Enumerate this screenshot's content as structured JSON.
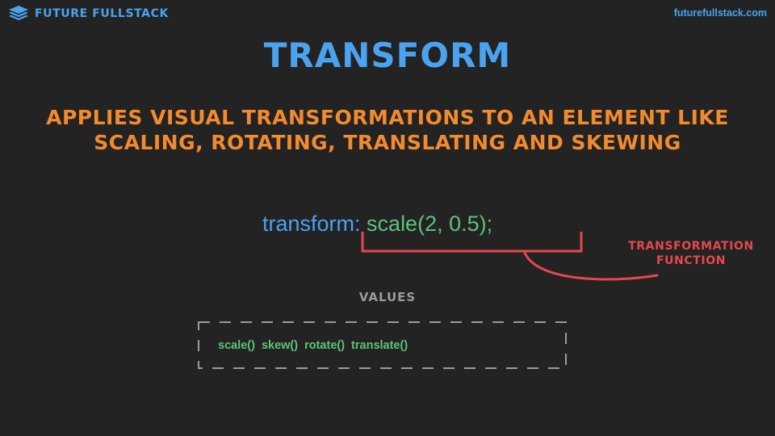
{
  "header": {
    "brand": "FUTURE FULLSTACK",
    "url": "futurefullstack.com",
    "logo_icon": "stacked-layers-icon",
    "accent_color": "#4aa3f0"
  },
  "slide": {
    "title": "TRANSFORM",
    "description_line1": "APPLIES VISUAL TRANSFORMATIONS TO AN ELEMENT LIKE",
    "description_line2": "SCALING, ROTATING, TRANSLATING AND SKEWING",
    "code_property": "transform:",
    "code_value": "scale(2, 0.5);",
    "annotation_line1": "TRANSFORMATION",
    "annotation_line2": "FUNCTION",
    "values_label": "VALUES",
    "values": [
      "scale()",
      "skew()",
      "rotate()",
      "translate()"
    ],
    "colors": {
      "background": "#232323",
      "title": "#4aa3f0",
      "description": "#f28a2e",
      "code_value": "#5ec27a",
      "annotation": "#e5484d",
      "muted": "#9a9a9a"
    }
  }
}
